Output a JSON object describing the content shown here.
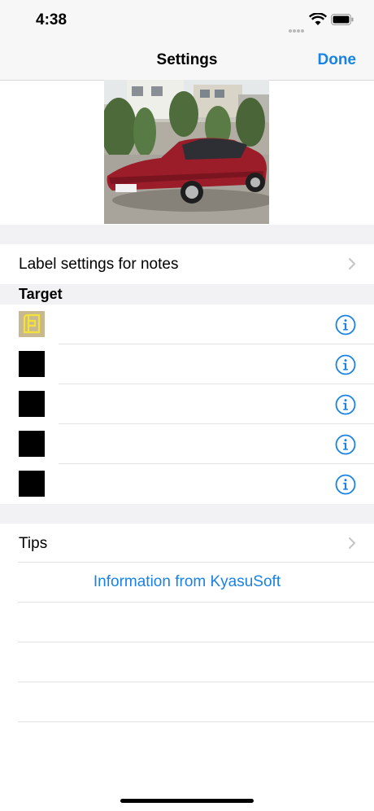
{
  "status_bar": {
    "time": "4:38"
  },
  "nav": {
    "title": "Settings",
    "done": "Done"
  },
  "settings": {
    "label_settings": "Label settings for notes",
    "section_target": "Target",
    "tips": "Tips",
    "info_link": "Information from KyasuSoft"
  },
  "colors": {
    "accent": "#1a82e2",
    "swatch_first_bg": "#c7b88f",
    "swatch_first_fg": "#f4e23a",
    "swatch_black": "#000000"
  }
}
